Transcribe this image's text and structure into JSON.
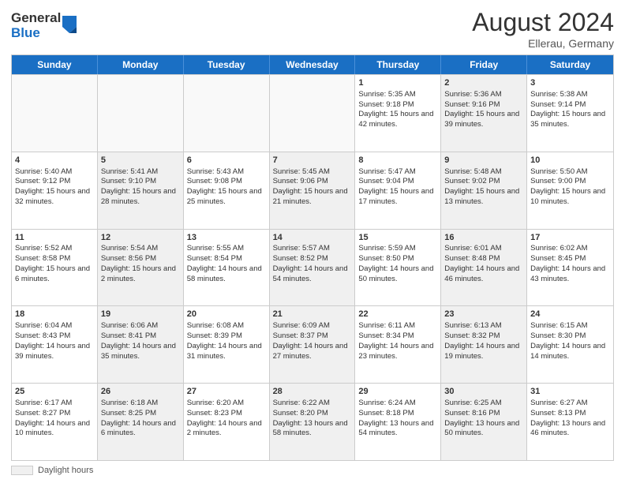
{
  "header": {
    "logo_general": "General",
    "logo_blue": "Blue",
    "month_year": "August 2024",
    "location": "Ellerau, Germany"
  },
  "footer": {
    "label": "Daylight hours"
  },
  "days_of_week": [
    "Sunday",
    "Monday",
    "Tuesday",
    "Wednesday",
    "Thursday",
    "Friday",
    "Saturday"
  ],
  "rows": [
    [
      {
        "day": "",
        "info": "",
        "shaded": false,
        "empty": true
      },
      {
        "day": "",
        "info": "",
        "shaded": false,
        "empty": true
      },
      {
        "day": "",
        "info": "",
        "shaded": false,
        "empty": true
      },
      {
        "day": "",
        "info": "",
        "shaded": false,
        "empty": true
      },
      {
        "day": "1",
        "info": "Sunrise: 5:35 AM\nSunset: 9:18 PM\nDaylight: 15 hours and 42 minutes.",
        "shaded": false,
        "empty": false
      },
      {
        "day": "2",
        "info": "Sunrise: 5:36 AM\nSunset: 9:16 PM\nDaylight: 15 hours and 39 minutes.",
        "shaded": true,
        "empty": false
      },
      {
        "day": "3",
        "info": "Sunrise: 5:38 AM\nSunset: 9:14 PM\nDaylight: 15 hours and 35 minutes.",
        "shaded": false,
        "empty": false
      }
    ],
    [
      {
        "day": "4",
        "info": "Sunrise: 5:40 AM\nSunset: 9:12 PM\nDaylight: 15 hours and 32 minutes.",
        "shaded": false,
        "empty": false
      },
      {
        "day": "5",
        "info": "Sunrise: 5:41 AM\nSunset: 9:10 PM\nDaylight: 15 hours and 28 minutes.",
        "shaded": true,
        "empty": false
      },
      {
        "day": "6",
        "info": "Sunrise: 5:43 AM\nSunset: 9:08 PM\nDaylight: 15 hours and 25 minutes.",
        "shaded": false,
        "empty": false
      },
      {
        "day": "7",
        "info": "Sunrise: 5:45 AM\nSunset: 9:06 PM\nDaylight: 15 hours and 21 minutes.",
        "shaded": true,
        "empty": false
      },
      {
        "day": "8",
        "info": "Sunrise: 5:47 AM\nSunset: 9:04 PM\nDaylight: 15 hours and 17 minutes.",
        "shaded": false,
        "empty": false
      },
      {
        "day": "9",
        "info": "Sunrise: 5:48 AM\nSunset: 9:02 PM\nDaylight: 15 hours and 13 minutes.",
        "shaded": true,
        "empty": false
      },
      {
        "day": "10",
        "info": "Sunrise: 5:50 AM\nSunset: 9:00 PM\nDaylight: 15 hours and 10 minutes.",
        "shaded": false,
        "empty": false
      }
    ],
    [
      {
        "day": "11",
        "info": "Sunrise: 5:52 AM\nSunset: 8:58 PM\nDaylight: 15 hours and 6 minutes.",
        "shaded": false,
        "empty": false
      },
      {
        "day": "12",
        "info": "Sunrise: 5:54 AM\nSunset: 8:56 PM\nDaylight: 15 hours and 2 minutes.",
        "shaded": true,
        "empty": false
      },
      {
        "day": "13",
        "info": "Sunrise: 5:55 AM\nSunset: 8:54 PM\nDaylight: 14 hours and 58 minutes.",
        "shaded": false,
        "empty": false
      },
      {
        "day": "14",
        "info": "Sunrise: 5:57 AM\nSunset: 8:52 PM\nDaylight: 14 hours and 54 minutes.",
        "shaded": true,
        "empty": false
      },
      {
        "day": "15",
        "info": "Sunrise: 5:59 AM\nSunset: 8:50 PM\nDaylight: 14 hours and 50 minutes.",
        "shaded": false,
        "empty": false
      },
      {
        "day": "16",
        "info": "Sunrise: 6:01 AM\nSunset: 8:48 PM\nDaylight: 14 hours and 46 minutes.",
        "shaded": true,
        "empty": false
      },
      {
        "day": "17",
        "info": "Sunrise: 6:02 AM\nSunset: 8:45 PM\nDaylight: 14 hours and 43 minutes.",
        "shaded": false,
        "empty": false
      }
    ],
    [
      {
        "day": "18",
        "info": "Sunrise: 6:04 AM\nSunset: 8:43 PM\nDaylight: 14 hours and 39 minutes.",
        "shaded": false,
        "empty": false
      },
      {
        "day": "19",
        "info": "Sunrise: 6:06 AM\nSunset: 8:41 PM\nDaylight: 14 hours and 35 minutes.",
        "shaded": true,
        "empty": false
      },
      {
        "day": "20",
        "info": "Sunrise: 6:08 AM\nSunset: 8:39 PM\nDaylight: 14 hours and 31 minutes.",
        "shaded": false,
        "empty": false
      },
      {
        "day": "21",
        "info": "Sunrise: 6:09 AM\nSunset: 8:37 PM\nDaylight: 14 hours and 27 minutes.",
        "shaded": true,
        "empty": false
      },
      {
        "day": "22",
        "info": "Sunrise: 6:11 AM\nSunset: 8:34 PM\nDaylight: 14 hours and 23 minutes.",
        "shaded": false,
        "empty": false
      },
      {
        "day": "23",
        "info": "Sunrise: 6:13 AM\nSunset: 8:32 PM\nDaylight: 14 hours and 19 minutes.",
        "shaded": true,
        "empty": false
      },
      {
        "day": "24",
        "info": "Sunrise: 6:15 AM\nSunset: 8:30 PM\nDaylight: 14 hours and 14 minutes.",
        "shaded": false,
        "empty": false
      }
    ],
    [
      {
        "day": "25",
        "info": "Sunrise: 6:17 AM\nSunset: 8:27 PM\nDaylight: 14 hours and 10 minutes.",
        "shaded": false,
        "empty": false
      },
      {
        "day": "26",
        "info": "Sunrise: 6:18 AM\nSunset: 8:25 PM\nDaylight: 14 hours and 6 minutes.",
        "shaded": true,
        "empty": false
      },
      {
        "day": "27",
        "info": "Sunrise: 6:20 AM\nSunset: 8:23 PM\nDaylight: 14 hours and 2 minutes.",
        "shaded": false,
        "empty": false
      },
      {
        "day": "28",
        "info": "Sunrise: 6:22 AM\nSunset: 8:20 PM\nDaylight: 13 hours and 58 minutes.",
        "shaded": true,
        "empty": false
      },
      {
        "day": "29",
        "info": "Sunrise: 6:24 AM\nSunset: 8:18 PM\nDaylight: 13 hours and 54 minutes.",
        "shaded": false,
        "empty": false
      },
      {
        "day": "30",
        "info": "Sunrise: 6:25 AM\nSunset: 8:16 PM\nDaylight: 13 hours and 50 minutes.",
        "shaded": true,
        "empty": false
      },
      {
        "day": "31",
        "info": "Sunrise: 6:27 AM\nSunset: 8:13 PM\nDaylight: 13 hours and 46 minutes.",
        "shaded": false,
        "empty": false
      }
    ]
  ]
}
